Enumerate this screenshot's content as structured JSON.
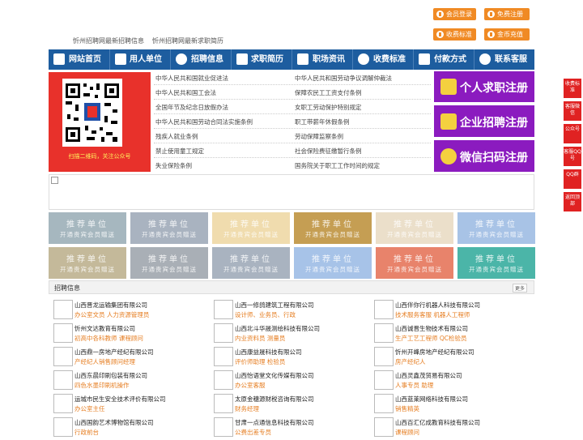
{
  "top_buttons": {
    "member_login": "会员登录",
    "free_register": "免费注册",
    "fee_standard": "收费标准",
    "gold_recharge": "金币充值"
  },
  "subtitle": [
    "忻州招聘网最新招聘信息",
    "忻州招聘网最新求职简历"
  ],
  "nav": [
    "网站首页",
    "用人单位",
    "招聘信息",
    "求职简历",
    "职场资讯",
    "收费标准",
    "付款方式",
    "联系客服"
  ],
  "qr": {
    "caption": "扫描二维码，关注公众号"
  },
  "laws_left": [
    "中华人民共和国就业促进法",
    "中华人民共和国工会法",
    "全国年节及纪念日放假办法",
    "中华人民共和国劳动合同法实施条例",
    "残疾人就业条例",
    "禁止使用童工规定",
    "失业保险条例"
  ],
  "laws_right": [
    "中华人民共和国劳动争议调解仲裁法",
    "保障农民工工资支付条例",
    "女职工劳动保护特别规定",
    "职工带薪年休假条例",
    "劳动保障监察条例",
    "社会保险费征缴暂行条例",
    "国务院关于职工工作时间的规定"
  ],
  "right_buttons": [
    "个人求职注册",
    "企业招聘注册",
    "微信扫码注册"
  ],
  "tiles": {
    "title": "推荐单位",
    "sub": "开通贵宾会员赠送",
    "colors": [
      "#a6b7bf",
      "#a9b3c0",
      "#f0dcae",
      "#c59e53",
      "#ebdfca",
      "#a8c3e6",
      "#c4b99a",
      "#a9afb6",
      "#a9b3c0",
      "#a7c3e8",
      "#e8836b",
      "#4bb5a8"
    ]
  },
  "recruit": {
    "title": "招聘信息",
    "more": "更多",
    "items": [
      {
        "company": "山西晋龙运输集团有限公司",
        "jobs": "办公室文员 人力资源管理员"
      },
      {
        "company": "山西一修鸽建筑工程有限公司",
        "jobs": "设计师、业务员、行政"
      },
      {
        "company": "山西伴你行机器人科技有限公司",
        "jobs": "技术服务客服 机器人工程师"
      },
      {
        "company": "忻州文达教育有限公司",
        "jobs": "初高中各科教师 课程顾问"
      },
      {
        "company": "山西北斗华晟测绘科技有限公司",
        "jobs": "内业资料员 测量员"
      },
      {
        "company": "山西诚晋生物技术有限公司",
        "jobs": "生产工艺工程师 QC检验员"
      },
      {
        "company": "山西鼎一房地产经纪有限公司",
        "jobs": "产经纪人销售顾问经理"
      },
      {
        "company": "山西康益晟科技有限公司",
        "jobs": "评价师助理 检验员"
      },
      {
        "company": "忻州开峰房地产经纪有限公司",
        "jobs": "房产经纪人"
      },
      {
        "company": "山西东晨印刷包装有限公司",
        "jobs": "四色水墨印刷机操作"
      },
      {
        "company": "山西怡语堂文化传媒有限公司",
        "jobs": "办公室客服"
      },
      {
        "company": "山西灵鑫茂贸易有限公司",
        "jobs": "人事专员 助理"
      },
      {
        "company": "运城市民生安全技术评价有限公司",
        "jobs": "办公室主任"
      },
      {
        "company": "太原金穗源财税咨询有限公司",
        "jobs": "财务经理"
      },
      {
        "company": "山西蓝莱网络科技有限公司",
        "jobs": "销售精英"
      },
      {
        "company": "山西国韵艺术博物馆有限公司",
        "jobs": "行政前台"
      },
      {
        "company": "甘肃一点通信息科技有限公司",
        "jobs": "公费出差专员"
      },
      {
        "company": "山西百汇亿成教育科技有限公司",
        "jobs": "课程顾问"
      }
    ]
  },
  "float_tabs": [
    "收费标准",
    "客服微信",
    "公众号",
    "客服QQ号",
    "QQ群",
    "返回顶部"
  ]
}
